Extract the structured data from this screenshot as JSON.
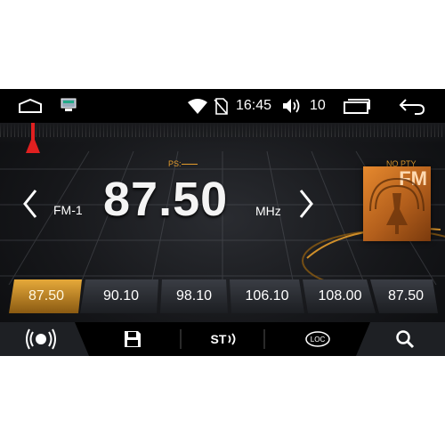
{
  "status_bar": {
    "time": "16:45",
    "volume": "10",
    "icons": [
      "home-icon",
      "screenshot-icon",
      "wifi-icon",
      "no-sim-icon",
      "volume-icon",
      "recent-apps-icon",
      "back-icon"
    ]
  },
  "radio": {
    "ps_label": "PS:",
    "frequency": "87.50",
    "band": "FM-1",
    "unit": "MHz",
    "pty_label": "NO PTY",
    "mode_tile": "FM"
  },
  "presets": [
    {
      "label": "87.50",
      "active": true
    },
    {
      "label": "90.10",
      "active": false
    },
    {
      "label": "98.10",
      "active": false
    },
    {
      "label": "106.10",
      "active": false
    },
    {
      "label": "108.00",
      "active": false
    },
    {
      "label": "87.50",
      "active": false
    }
  ],
  "bottom_bar": {
    "st_label": "ST",
    "loc_label": "LOC",
    "icons": [
      "radio-signal-icon",
      "save-icon",
      "stereo-icon",
      "loc-icon",
      "search-icon"
    ]
  },
  "colors": {
    "accent": "#e39b2b",
    "active_preset": "#c9871f",
    "tuner_marker": "#e02020"
  }
}
